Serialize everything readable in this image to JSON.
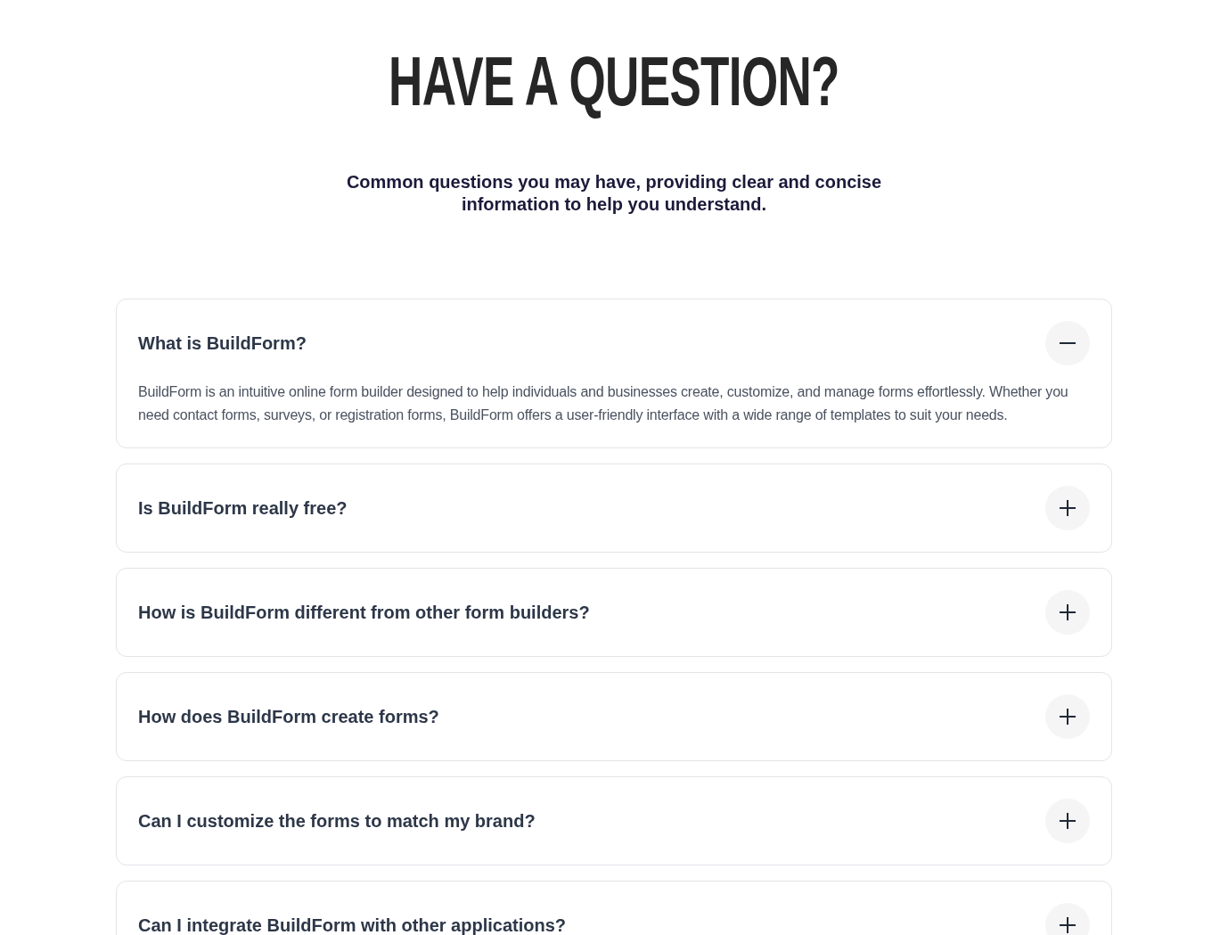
{
  "heading": "HAVE A QUESTION?",
  "subtitle": "Common questions you may have, providing clear and concise information to help you understand.",
  "faqs": [
    {
      "question": "What is BuildForm?",
      "expanded": true,
      "answer": "BuildForm is an intuitive online form builder designed to help individuals and businesses create, customize, and manage forms effortlessly. Whether you need contact forms, surveys, or registration forms, BuildForm offers a user-friendly interface with a wide range of templates to suit your needs."
    },
    {
      "question": "Is BuildForm really free?",
      "expanded": false
    },
    {
      "question": "How is BuildForm different from other form builders?",
      "expanded": false
    },
    {
      "question": "How does BuildForm create forms?",
      "expanded": false
    },
    {
      "question": "Can I customize the forms to match my brand?",
      "expanded": false
    },
    {
      "question": "Can I integrate BuildForm with other applications?",
      "expanded": false
    }
  ]
}
